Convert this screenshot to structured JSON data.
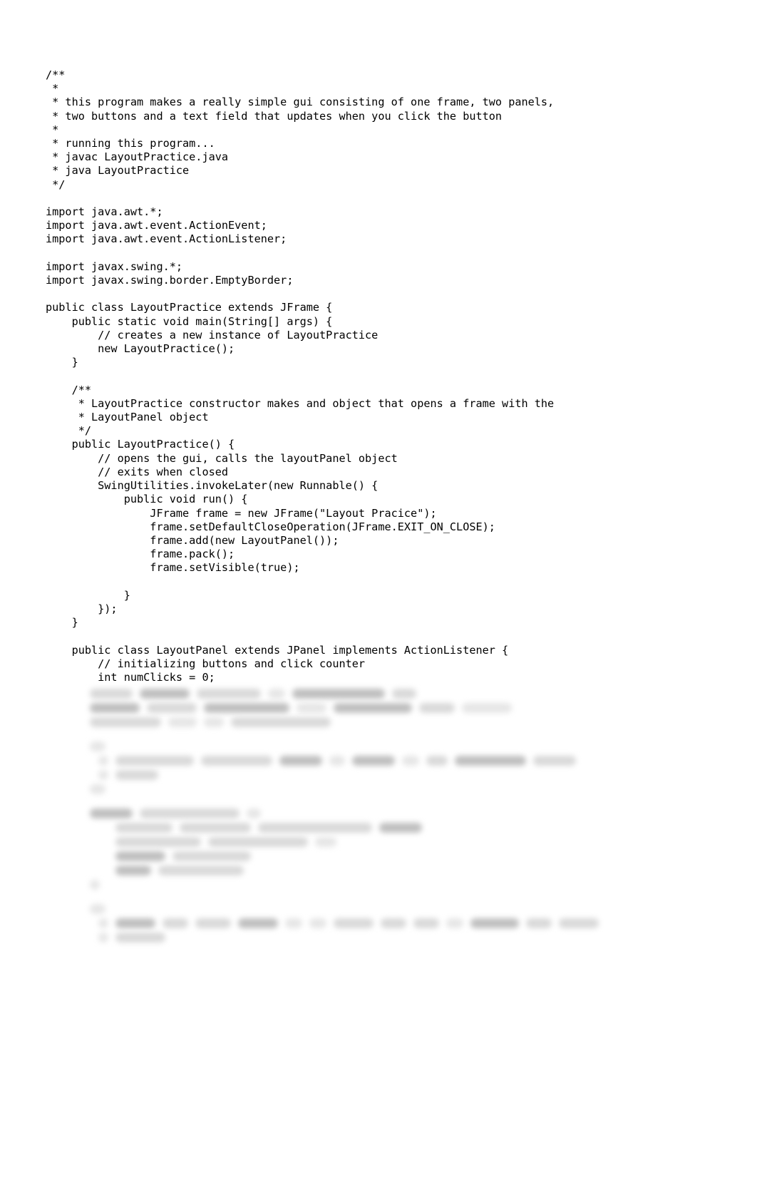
{
  "code_lines": [
    "/**",
    " *",
    " * this program makes a really simple gui consisting of one frame, two panels,",
    " * two buttons and a text field that updates when you click the button",
    " *",
    " * running this program...",
    " * javac LayoutPractice.java",
    " * java LayoutPractice",
    " */",
    "",
    "import java.awt.*;",
    "import java.awt.event.ActionEvent;",
    "import java.awt.event.ActionListener;",
    "",
    "import javax.swing.*;",
    "import javax.swing.border.EmptyBorder;",
    "",
    "public class LayoutPractice extends JFrame {",
    "    public static void main(String[] args) {",
    "        // creates a new instance of LayoutPractice",
    "        new LayoutPractice();",
    "    }",
    "",
    "    /**",
    "     * LayoutPractice constructor makes and object that opens a frame with the",
    "     * LayoutPanel object",
    "     */",
    "    public LayoutPractice() {",
    "        // opens the gui, calls the layoutPanel object",
    "        // exits when closed",
    "        SwingUtilities.invokeLater(new Runnable() {",
    "            public void run() {",
    "                JFrame frame = new JFrame(\"Layout Pracice\");",
    "                frame.setDefaultCloseOperation(JFrame.EXIT_ON_CLOSE);",
    "                frame.add(new LayoutPanel());",
    "                frame.pack();",
    "                frame.setVisible(true);",
    "",
    "            }",
    "        });",
    "    }",
    "",
    "    public class LayoutPanel extends JPanel implements ActionListener {",
    "        // initializing buttons and click counter",
    "        int numClicks = 0;"
  ]
}
